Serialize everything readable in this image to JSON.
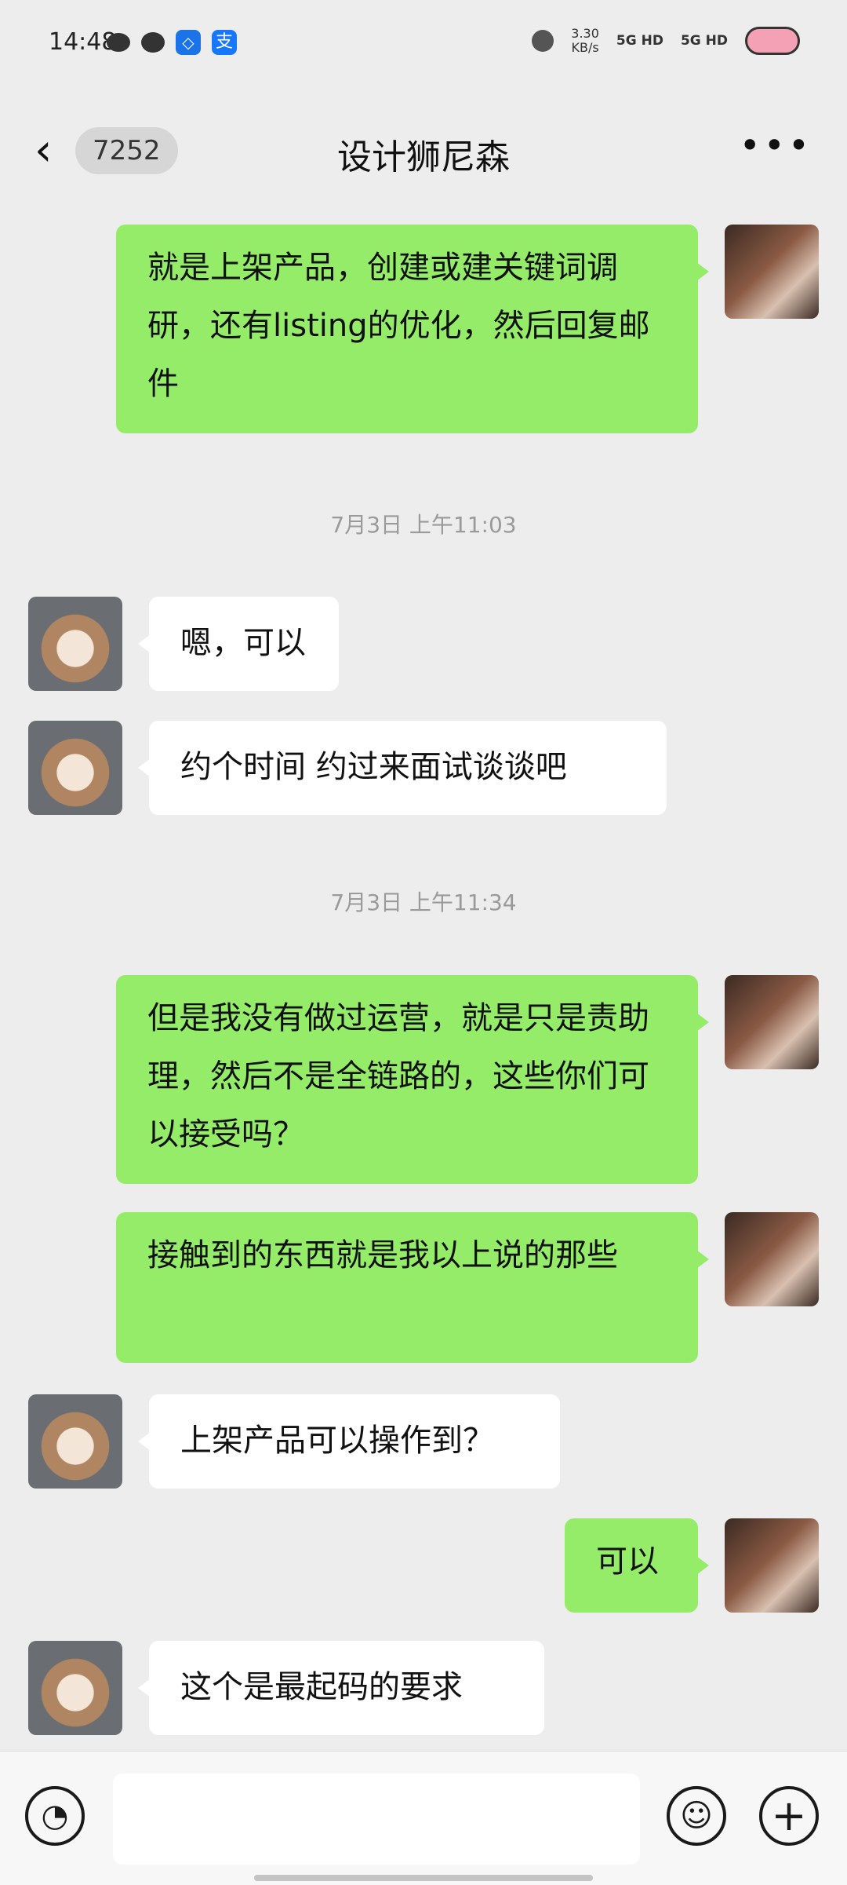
{
  "status_bar": {
    "time": "14:48",
    "net_speed": "3.30",
    "net_speed_unit": "KB/s",
    "signal_1": "5G HD",
    "signal_2": "5G HD",
    "notification_icons": [
      "wechat-icon",
      "message-icon",
      "app-icon",
      "alipay-icon"
    ]
  },
  "header": {
    "back_label": "‹",
    "unread_count": "7252",
    "title": "设计狮尼森",
    "more_label": "•••"
  },
  "messages": [
    {
      "side": "me",
      "text": "就是上架产品，创建或建关键词调研，还有listing的优化，然后回复邮件"
    },
    {
      "type": "timestamp",
      "text": "7月3日 上午11:03"
    },
    {
      "side": "them",
      "text": "嗯，可以"
    },
    {
      "side": "them",
      "text": "约个时间 约过来面试谈谈吧"
    },
    {
      "type": "timestamp",
      "text": "7月3日 上午11:34"
    },
    {
      "side": "me",
      "text": "但是我没有做过运营，就是只是责助理，然后不是全链路的，这些你们可以接受吗？"
    },
    {
      "side": "me",
      "text": "接触到的东西就是我以上说的那些"
    },
    {
      "side": "them",
      "text": "上架产品可以操作到？"
    },
    {
      "side": "me",
      "text": "可以"
    },
    {
      "side": "them",
      "text": "这个是最起码的要求"
    }
  ],
  "bottom_bar": {
    "voice_icon": "voice-icon",
    "emoji_icon": "emoji-icon",
    "plus_icon": "plus-icon"
  },
  "colors": {
    "my_bubble": "#95ec69",
    "their_bubble": "#ffffff",
    "background": "#ededed"
  }
}
